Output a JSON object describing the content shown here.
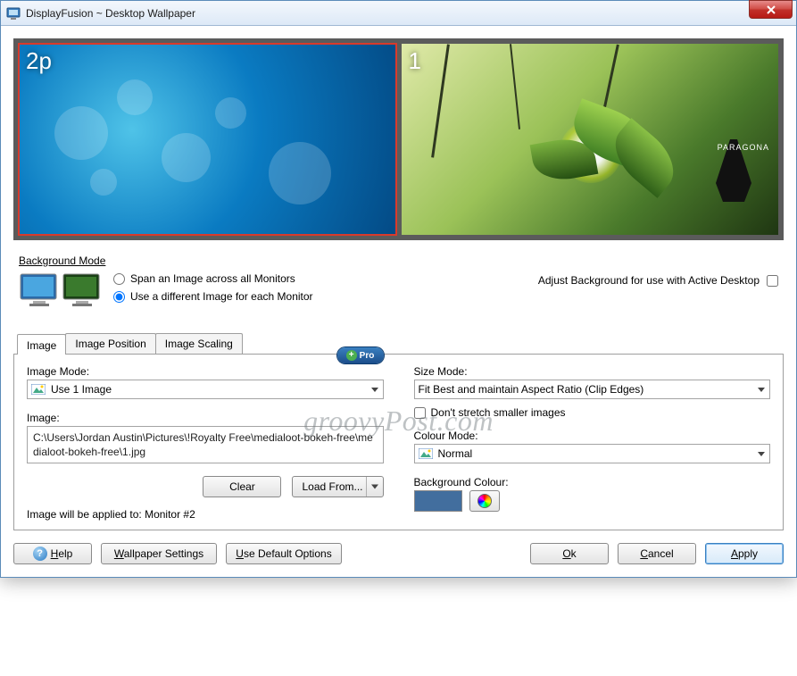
{
  "window": {
    "title": "DisplayFusion ~ Desktop Wallpaper"
  },
  "watermark": "groovyPost.com",
  "previews": [
    {
      "label": "2p",
      "selected": true
    },
    {
      "label": "1",
      "selected": false,
      "brand": "PARAGONA"
    }
  ],
  "background_mode": {
    "section_label": "Background Mode",
    "span_label": "Span an Image across all Monitors",
    "diff_label": "Use a different Image for each Monitor",
    "selected": "diff",
    "adjust_label": "Adjust Background for use with Active Desktop",
    "adjust_checked": false
  },
  "tabs": {
    "items": [
      "Image",
      "Image Position",
      "Image Scaling"
    ],
    "active": 0
  },
  "image_tab": {
    "pro_label": "Pro",
    "image_mode_label": "Image Mode:",
    "image_mode_value": "Use 1 Image",
    "image_label": "Image:",
    "image_path": "C:\\Users\\Jordan Austin\\Pictures\\!Royalty Free\\medialoot-bokeh-free\\medialoot-bokeh-free\\1.jpg",
    "clear_btn": "Clear",
    "loadfrom_btn": "Load From...",
    "applied_note": "Image will be applied to: Monitor #2",
    "size_mode_label": "Size Mode:",
    "size_mode_value": "Fit Best and maintain Aspect Ratio (Clip Edges)",
    "dont_stretch_label": "Don't stretch smaller images",
    "dont_stretch_checked": false,
    "colour_mode_label": "Colour Mode:",
    "colour_mode_value": "Normal",
    "bgcolour_label": "Background Colour:",
    "bgcolour_value": "#426e9e"
  },
  "buttons": {
    "help": "Help",
    "wallpaper_settings": "Wallpaper Settings",
    "use_default": "Use Default Options",
    "ok": "Ok",
    "cancel": "Cancel",
    "apply": "Apply"
  }
}
